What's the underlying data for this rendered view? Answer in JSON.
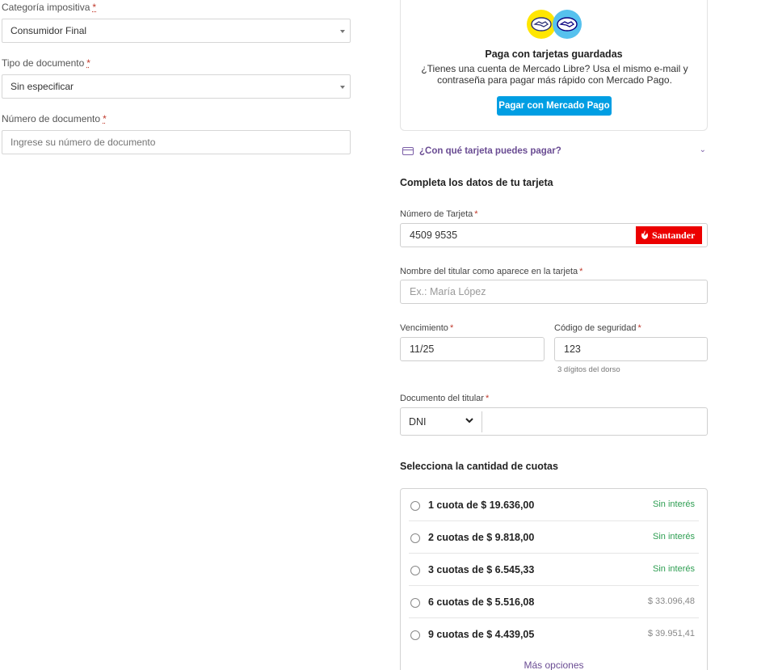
{
  "billing": {
    "tax_category": {
      "label": "Categoría impositiva",
      "required_mark": "*",
      "value": "Consumidor Final"
    },
    "document_type": {
      "label": "Tipo de documento",
      "required_mark": "*",
      "value": "Sin especificar"
    },
    "document_number": {
      "label": "Número de documento",
      "required_mark": "*",
      "placeholder": "Ingrese su número de documento"
    }
  },
  "promo": {
    "title": "Paga con tarjetas guardadas",
    "text": "¿Tienes una cuenta de Mercado Libre? Usa el mismo e-mail y contraseña para pagar más rápido con Mercado Pago.",
    "button": "Pagar con Mercado Pago"
  },
  "which_card": {
    "label": "¿Con qué tarjeta puedes pagar?",
    "chevron": "⌄"
  },
  "card_form": {
    "title": "Completa los datos de tu tarjeta",
    "card_number": {
      "label": "Número de Tarjeta",
      "required_mark": "*",
      "value": "4509 9535",
      "brand": "Santander"
    },
    "holder_name": {
      "label": "Nombre del titular como aparece en la tarjeta",
      "required_mark": "*",
      "placeholder": "Ex.: María López"
    },
    "expiry": {
      "label": "Vencimiento",
      "required_mark": "*",
      "value": "11/25"
    },
    "cvv": {
      "label": "Código de seguridad",
      "required_mark": "*",
      "value": "123",
      "hint": "3 dígitos del dorso"
    },
    "holder_doc": {
      "label": "Documento del titular",
      "required_mark": "*",
      "type": "DNI",
      "value": ""
    }
  },
  "installments": {
    "title": "Selecciona la cantidad de cuotas",
    "options": [
      {
        "label": "1 cuota de $ 19.636,00",
        "note": "Sin interés",
        "note_color": "#2e9e52"
      },
      {
        "label": "2 cuotas de $ 9.818,00",
        "note": "Sin interés",
        "note_color": "#2e9e52"
      },
      {
        "label": "3 cuotas de $ 6.545,33",
        "note": "Sin interés",
        "note_color": "#2e9e52"
      },
      {
        "label": "6 cuotas de $ 5.516,08",
        "note": "$ 33.096,48",
        "note_color": "#888888"
      },
      {
        "label": "9 cuotas de $ 4.439,05",
        "note": "$ 39.951,41",
        "note_color": "#888888"
      }
    ],
    "more": "Más opciones"
  },
  "colors": {
    "accent_blue": "#009ee3",
    "link_purple": "#6a4c93",
    "required_red": "#c0392b",
    "santander_red": "#ec0000",
    "mp_yellow": "#ffe600"
  }
}
